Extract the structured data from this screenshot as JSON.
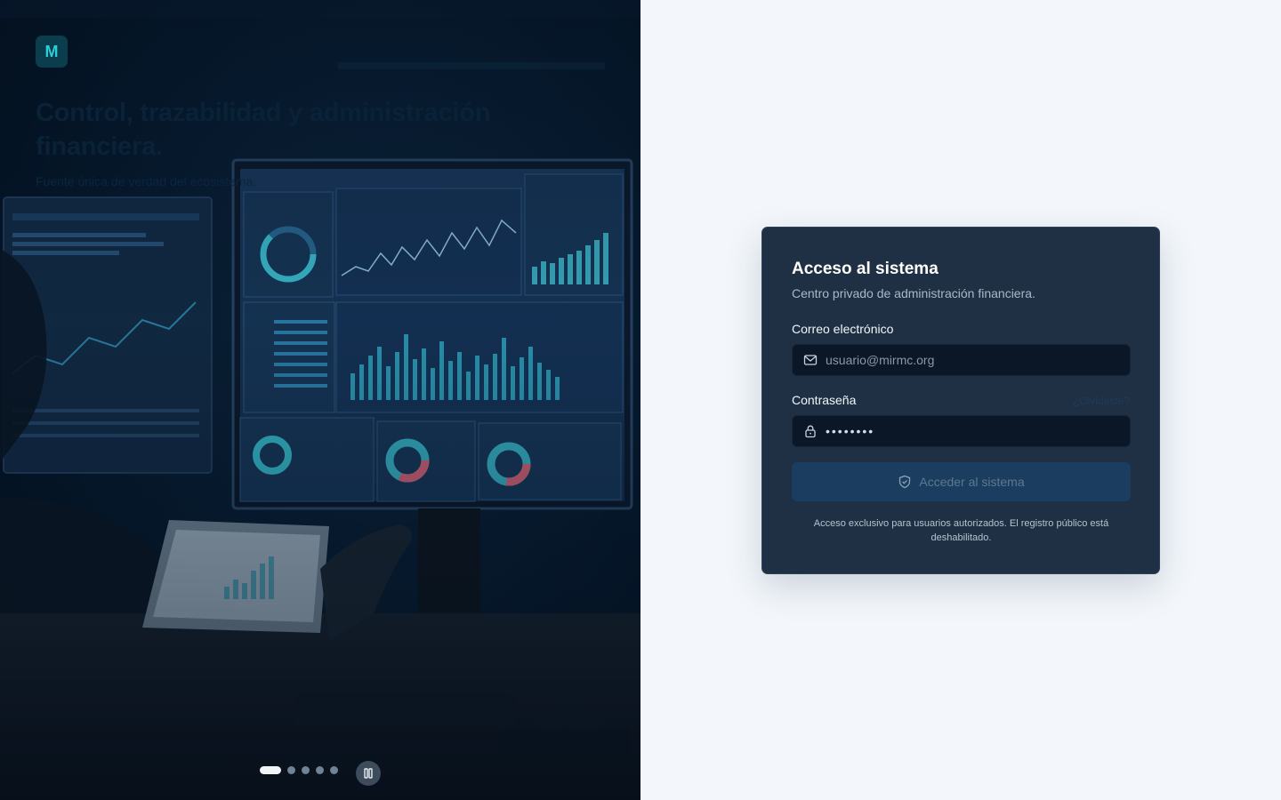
{
  "hero": {
    "logo_letter": "M",
    "title": "Control, trazabilidad y administración financiera.",
    "subtitle": "Fuente única de verdad del ecosistema.",
    "slides_count": 5,
    "active_slide": 1
  },
  "login": {
    "title": "Acceso al sistema",
    "subtitle": "Centro privado de administración financiera.",
    "email_label": "Correo electrónico",
    "email_placeholder": "usuario@mirmc.org",
    "password_label": "Contraseña",
    "password_value": "••••••••",
    "forgot_label": "¿Olvidaste?",
    "submit_label": "Acceder al sistema",
    "note": "Acceso exclusivo para usuarios autorizados. El registro público está deshabilitado."
  },
  "colors": {
    "accent": "#2ad0d8",
    "card_bg": "#1f3044",
    "page_bg": "#f3f7fb"
  },
  "icons": {
    "email": "mail-icon",
    "password": "lock-icon",
    "submit": "shield-icon",
    "pause": "pause-icon"
  }
}
